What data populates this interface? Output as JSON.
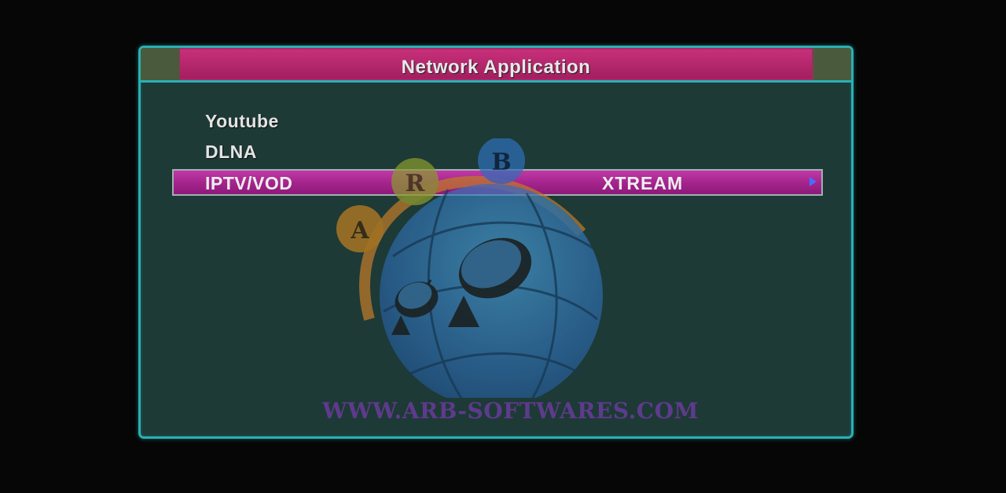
{
  "window": {
    "title": "Network Application"
  },
  "menu": {
    "items": [
      {
        "label": "Youtube"
      },
      {
        "label": "DLNA"
      },
      {
        "label": "IPTV/VOD",
        "value": "XTREAM",
        "selected": true
      }
    ]
  },
  "watermark": {
    "url": "WWW.ARB-SOFTWARES.COM",
    "logo_letters": [
      "A",
      "R",
      "B"
    ]
  },
  "colors": {
    "frame": "#2ab0b4",
    "panel_bg": "#1d3a36",
    "title_bar": "#b1256a",
    "selected_row": "#a3238b",
    "arrow": "#4a6cff"
  }
}
